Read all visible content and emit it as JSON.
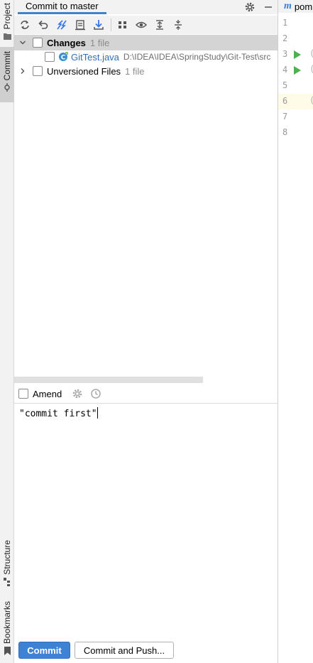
{
  "left_stripe": {
    "project_label": "Project",
    "commit_label": "Commit",
    "structure_label": "Structure",
    "bookmarks_label": "Bookmarks"
  },
  "panel": {
    "title": "Commit to master",
    "accent_color": "#4083c9"
  },
  "toolbar": {
    "icons": [
      "refresh-icon",
      "rollback-icon",
      "diff-icon",
      "shelve-icon",
      "update-icon",
      "group-by-icon",
      "show-icon",
      "expand-all-icon",
      "collapse-all-icon"
    ]
  },
  "tree": {
    "changes": {
      "label": "Changes",
      "count": "1 file"
    },
    "file": {
      "name": "GitTest.java",
      "path": "D:\\IDEA\\IDEA\\SpringStudy\\Git-Test\\src"
    },
    "unversioned": {
      "label": "Unversioned Files",
      "count": "1 file"
    }
  },
  "amend": {
    "label": "Amend"
  },
  "message": {
    "text": "\"commit first\""
  },
  "buttons": {
    "commit": "Commit",
    "commit_and_push": "Commit and Push...",
    "primary_color": "#3e82d4"
  },
  "editor": {
    "tab_icon": "m",
    "tab_label": "pom.xml",
    "line_numbers": [
      "1",
      "2",
      "3",
      "4",
      "5",
      "6",
      "7",
      "8"
    ]
  }
}
